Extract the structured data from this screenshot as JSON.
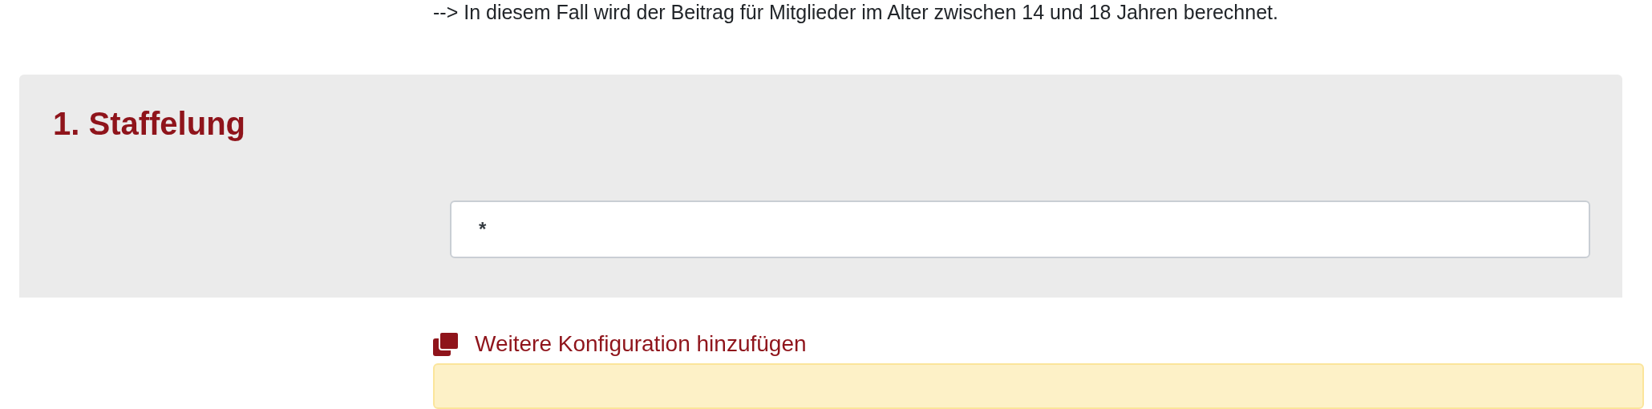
{
  "intro_text": "--> In diesem Fall wird der Beitrag für Mitglieder im Alter zwischen 14 und 18 Jahren berechnet.",
  "section": {
    "title": "1. Staffelung",
    "field": {
      "value": "*"
    }
  },
  "add_link": {
    "label": "Weitere Konfiguration hinzufügen"
  },
  "notice": {
    "kind": "warning"
  }
}
